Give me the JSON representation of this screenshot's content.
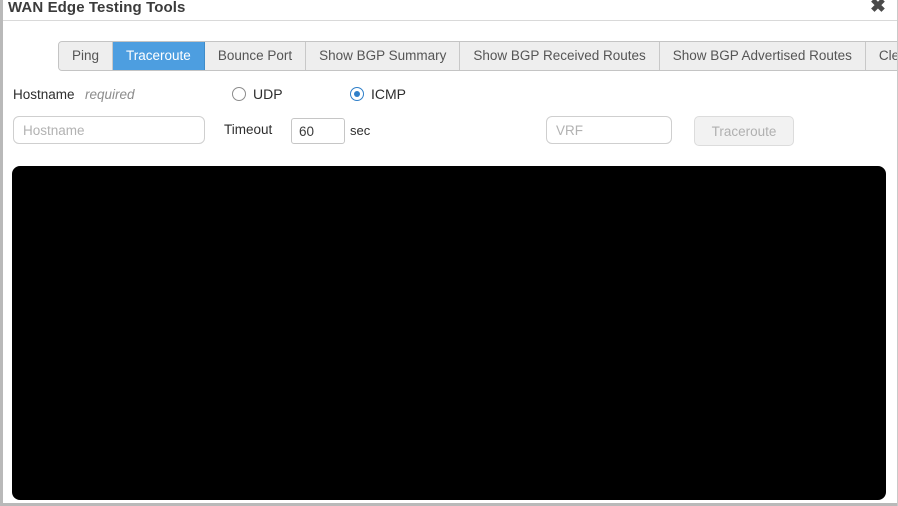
{
  "window": {
    "title": "WAN Edge Testing Tools",
    "close_icon": "close-icon",
    "close_glyph": "✖"
  },
  "tabs": [
    {
      "label": "Ping",
      "active": false
    },
    {
      "label": "Traceroute",
      "active": true
    },
    {
      "label": "Bounce Port",
      "active": false
    },
    {
      "label": "Show BGP Summary",
      "active": false
    },
    {
      "label": "Show BGP Received Routes",
      "active": false
    },
    {
      "label": "Show BGP Advertised Routes",
      "active": false
    },
    {
      "label": "Clear BGP",
      "active": false
    }
  ],
  "form": {
    "hostname_label": "Hostname",
    "hostname_required": "required",
    "hostname_value": "",
    "hostname_placeholder": "Hostname",
    "protocol": {
      "options": [
        {
          "label": "UDP",
          "selected": false
        },
        {
          "label": "ICMP",
          "selected": true
        }
      ]
    },
    "timeout_label": "Timeout",
    "timeout_value": "60",
    "timeout_unit": "sec",
    "vrf_value": "",
    "vrf_placeholder": "VRF",
    "submit_label": "Traceroute",
    "submit_disabled": true
  },
  "console": {
    "output": ""
  },
  "colors": {
    "accent": "#4d9ee0",
    "radio_accent": "#2f7fc9",
    "console_bg": "#000000",
    "border": "#c4c4c4",
    "title_text": "#3b3b3b"
  }
}
